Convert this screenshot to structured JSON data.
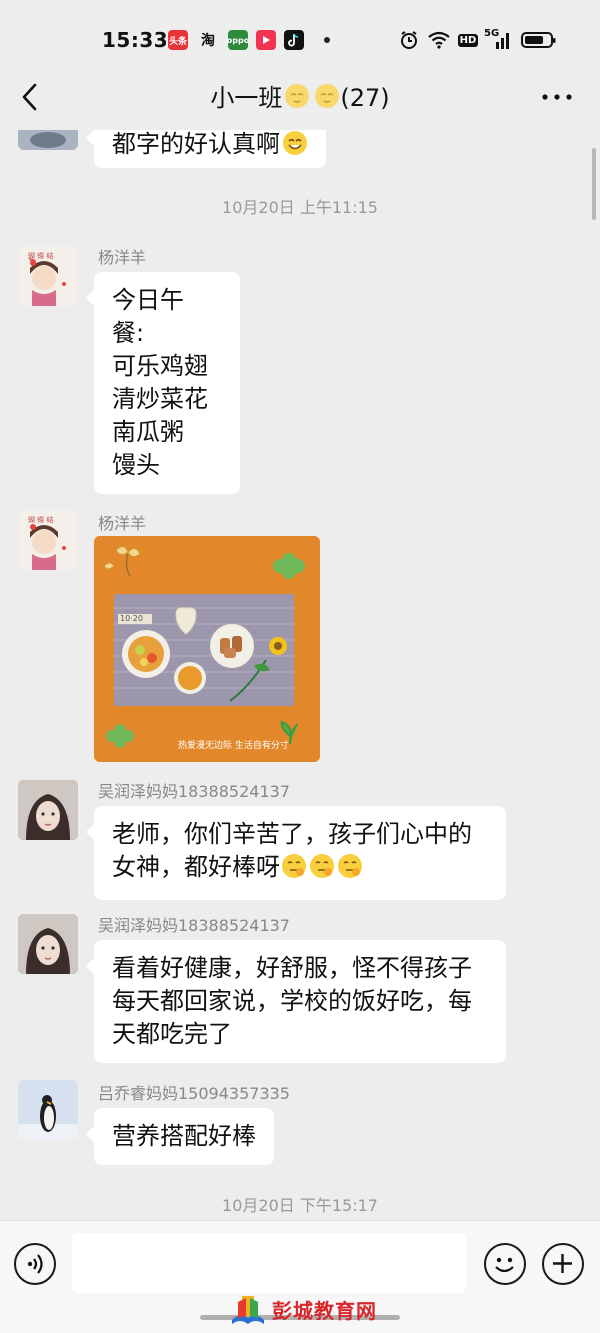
{
  "status_bar": {
    "time": "15:33",
    "app_icons": [
      {
        "name": "toutiao-icon",
        "label": "头条",
        "color": "#e8333a"
      },
      {
        "name": "taobao-icon",
        "label": "淘",
        "color": "#ffffff"
      },
      {
        "name": "oppo-icon",
        "label": "oppo",
        "color": "#2e8b3c"
      },
      {
        "name": "video-icon",
        "label": "",
        "color": "#f0334f"
      },
      {
        "name": "tiktok-icon",
        "label": "",
        "color": "#111111"
      }
    ],
    "network_label": "HD",
    "signal_label": "5G"
  },
  "nav": {
    "title": "小一班",
    "member_count": "(27)"
  },
  "messages": [
    {
      "text": "都字的好认真啊"
    },
    {
      "timestamp": "10月20日 上午11:15"
    },
    {
      "sender": "杨洋羊",
      "lines": [
        "今日午",
        "餐:",
        "可乐鸡翅",
        "清炒菜花",
        "南瓜粥",
        "馒头"
      ]
    },
    {
      "sender": "杨洋羊",
      "image_caption": "热爱漫无边际 生活自有分寸",
      "image_tag": "10·20"
    },
    {
      "sender": "吴润泽妈妈18388524137",
      "lines": [
        "老师，你们辛苦了，孩子们心中的",
        "女神，都好棒呀"
      ]
    },
    {
      "sender": "吴润泽妈妈18388524137",
      "lines": [
        "看着好健康，好舒服，怪不得孩子",
        "每天都回家说，学校的饭好吃，每",
        "天都吃完了"
      ]
    },
    {
      "sender": "吕乔睿妈妈15094357335",
      "lines": [
        "营养搭配好棒"
      ]
    },
    {
      "timestamp": "10月20日 下午15:17"
    }
  ],
  "input": {
    "placeholder": ""
  },
  "watermark": {
    "text": "彭城教育网"
  },
  "colors": {
    "background": "#ededed",
    "bubble": "#ffffff",
    "photo_bg": "#e2882a",
    "watermark": "#d8262b"
  }
}
